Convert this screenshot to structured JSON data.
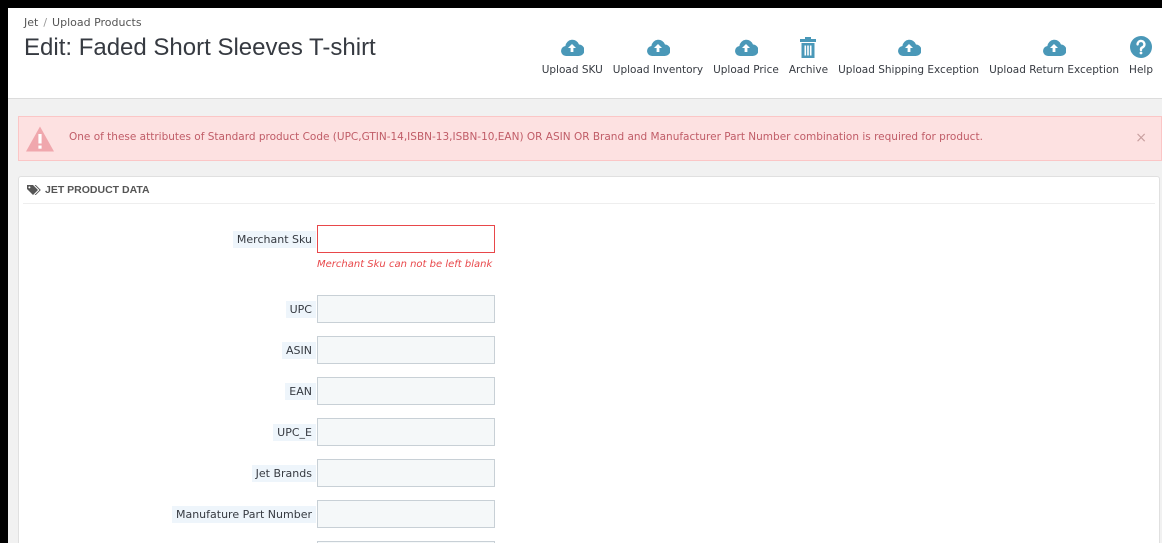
{
  "breadcrumb": {
    "root": "Jet",
    "separator": "/",
    "current": "Upload Products"
  },
  "page": {
    "title": "Edit: Faded Short Sleeves T-shirt"
  },
  "toolbar": [
    {
      "label": "Upload SKU",
      "icon": "cloud-upload-icon"
    },
    {
      "label": "Upload Inventory",
      "icon": "cloud-upload-icon"
    },
    {
      "label": "Upload Price",
      "icon": "cloud-upload-icon"
    },
    {
      "label": "Archive",
      "icon": "trash-icon"
    },
    {
      "label": "Upload Shipping Exception",
      "icon": "cloud-upload-icon"
    },
    {
      "label": "Upload Return Exception",
      "icon": "cloud-upload-icon"
    },
    {
      "label": "Help",
      "icon": "help-icon"
    }
  ],
  "alert": {
    "message": "One of these attributes of Standard product Code (UPC,GTIN-14,ISBN-13,ISBN-10,EAN) OR ASIN OR Brand and Manufacturer Part Number combination is required for product.",
    "close": "×"
  },
  "panel": {
    "heading": "JET PRODUCT DATA"
  },
  "form": {
    "fields": [
      {
        "label": "Merchant Sku",
        "value": ""
      },
      {
        "label": "UPC",
        "value": ""
      },
      {
        "label": "ASIN",
        "value": ""
      },
      {
        "label": "EAN",
        "value": ""
      },
      {
        "label": "UPC_E",
        "value": ""
      },
      {
        "label": "Jet Brands",
        "value": ""
      },
      {
        "label": "Manufature Part Number",
        "value": ""
      },
      {
        "label": "",
        "value": ""
      }
    ],
    "error": "Merchant Sku can not be left blank"
  },
  "colors": {
    "accent": "#25b9d7",
    "toolbar_icon": "#4a98b8",
    "alert_bg": "#fde1e1",
    "alert_text": "#c05c67",
    "error": "#e8474a"
  }
}
